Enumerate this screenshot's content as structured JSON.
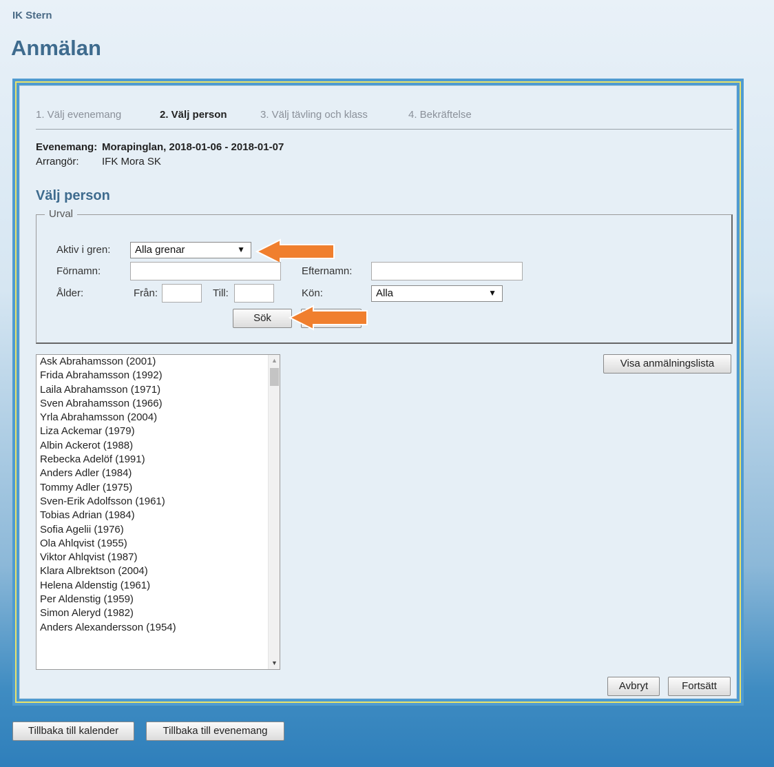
{
  "club_name": "IK Stern",
  "page_title": "Anmälan",
  "steps": [
    {
      "label": "1. Välj evenemang",
      "active": false
    },
    {
      "label": "2. Välj person",
      "active": true
    },
    {
      "label": "3. Välj tävling och klass",
      "active": false
    },
    {
      "label": "4. Bekräftelse",
      "active": false
    }
  ],
  "event": {
    "label": "Evenemang:",
    "value": "Morapinglan, 2018-01-06 - 2018-01-07",
    "organizer_label": "Arrangör:",
    "organizer_value": "IFK Mora SK"
  },
  "section_title": "Välj person",
  "filter": {
    "legend": "Urval",
    "branch_label": "Aktiv i gren:",
    "branch_value": "Alla grenar",
    "firstname_label": "Förnamn:",
    "firstname_value": "",
    "lastname_label": "Efternamn:",
    "lastname_value": "",
    "age_label": "Ålder:",
    "from_label": "Från:",
    "from_value": "",
    "to_label": "Till:",
    "to_value": "",
    "gender_label": "Kön:",
    "gender_value": "Alla",
    "search_button": "Sök"
  },
  "persons": [
    "Ask Abrahamsson (2001)",
    "Frida Abrahamsson (1992)",
    "Laila Abrahamsson (1971)",
    "Sven Abrahamsson (1966)",
    "Yrla Abrahamsson (2004)",
    "Liza Ackemar (1979)",
    "Albin Ackerot (1988)",
    "Rebecka Adelöf (1991)",
    "Anders Adler (1984)",
    "Tommy Adler (1975)",
    "Sven-Erik Adolfsson (1961)",
    "Tobias Adrian (1984)",
    "Sofia Agelii (1976)",
    "Ola Ahlqvist (1955)",
    "Viktor Ahlqvist (1987)",
    "Klara Albrektson (2004)",
    "Helena Aldenstig (1961)",
    "Per Aldenstig (1959)",
    "Simon Aleryd (1982)",
    "Anders Alexandersson (1954)"
  ],
  "show_list_button": "Visa anmälningslista",
  "cancel_button": "Avbryt",
  "continue_button": "Fortsätt",
  "back_calendar_button": "Tillbaka till kalender",
  "back_event_button": "Tillbaka till evenemang",
  "colors": {
    "accent": "#3e6b8e",
    "frame": "#4f9bd1",
    "frame_border": "#e9e36a",
    "arrow": "#f07f2e"
  }
}
